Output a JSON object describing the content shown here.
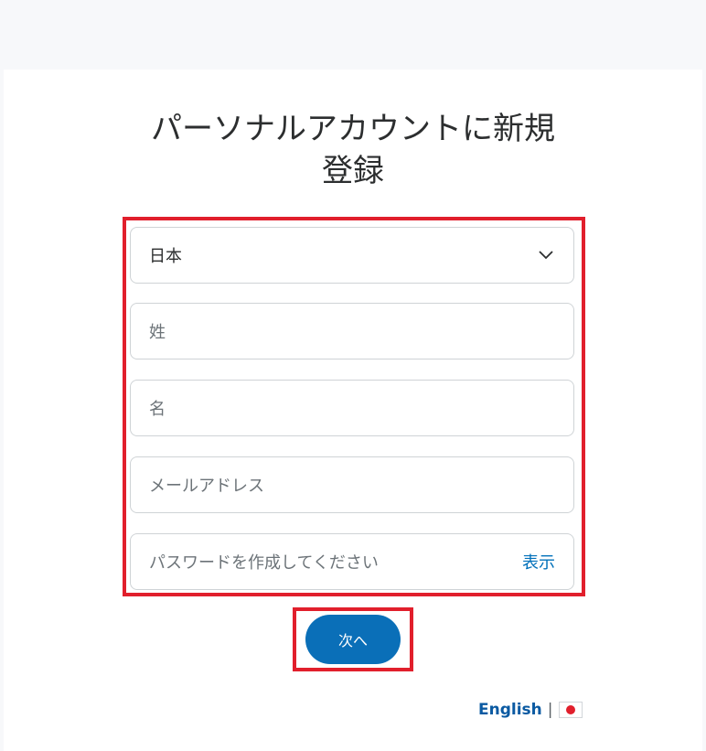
{
  "title": "パーソナルアカウントに新規登録",
  "form": {
    "country": "日本",
    "last_name_placeholder": "姓",
    "first_name_placeholder": "名",
    "email_placeholder": "メールアドレス",
    "password_placeholder": "パスワードを作成してください",
    "show_label": "表示"
  },
  "actions": {
    "next_label": "次へ"
  },
  "language": {
    "english_label": "English",
    "separator": "|",
    "flag": "japan-flag-icon"
  },
  "colors": {
    "accent": "#0a6fb8",
    "highlight": "#e11f2c",
    "link": "#0070ba"
  }
}
